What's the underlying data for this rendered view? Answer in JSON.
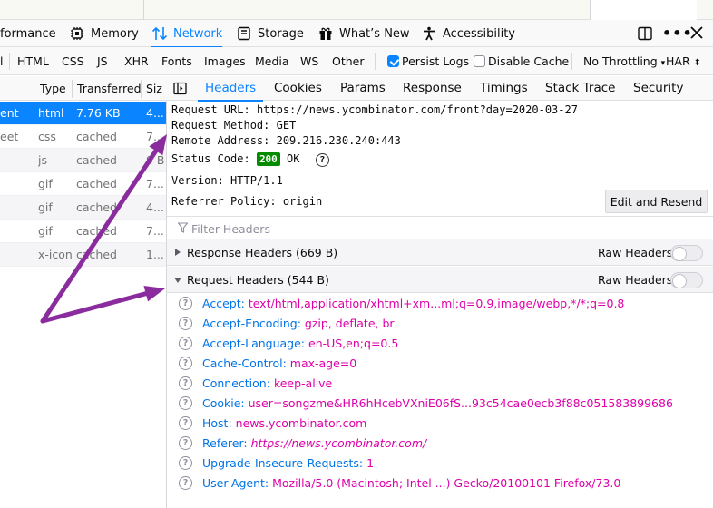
{
  "toolbar": {
    "tabs": [
      {
        "label": "formance",
        "icon": "performance-icon"
      },
      {
        "label": "Memory",
        "icon": "memory-icon"
      },
      {
        "label": "Network",
        "icon": "network-icon",
        "active": true
      },
      {
        "label": "Storage",
        "icon": "storage-icon"
      },
      {
        "label": "What’s New",
        "icon": "gift-icon"
      },
      {
        "label": "Accessibility",
        "icon": "accessibility-icon"
      }
    ],
    "dock_icon": "dock-side-icon",
    "more_icon": "more-icon",
    "close_icon": "close-icon"
  },
  "filterbar": {
    "types": [
      "l",
      "HTML",
      "CSS",
      "JS",
      "XHR",
      "Fonts",
      "Images",
      "Media",
      "WS",
      "Other"
    ],
    "persist_logs": {
      "label": "Persist Logs",
      "checked": true
    },
    "disable_cache": {
      "label": "Disable Cache",
      "checked": false
    },
    "throttling": "No Throttling",
    "har": "HAR"
  },
  "request_list": {
    "columns": [
      "Type",
      "Transferred",
      "Siz"
    ],
    "rows": [
      {
        "name": "ent",
        "type": "html",
        "transferred": "7.76 KB",
        "size": "4...",
        "selected": true
      },
      {
        "name": "eet",
        "type": "css",
        "transferred": "cached",
        "size": "7..."
      },
      {
        "name": "",
        "type": "js",
        "transferred": "cached",
        "size": "9 B"
      },
      {
        "name": "",
        "type": "gif",
        "transferred": "cached",
        "size": "7..."
      },
      {
        "name": "",
        "type": "gif",
        "transferred": "cached",
        "size": "4..."
      },
      {
        "name": "",
        "type": "gif",
        "transferred": "cached",
        "size": "7..."
      },
      {
        "name": "",
        "type": "x-icon",
        "transferred": "cached",
        "size": "1..."
      }
    ]
  },
  "details": {
    "tabs": [
      "Headers",
      "Cookies",
      "Params",
      "Response",
      "Timings",
      "Stack Trace",
      "Security"
    ],
    "active_tab": "Headers",
    "request_url_label": "Request URL:",
    "request_url": "https://news.ycombinator.com/front?day=2020-03-27",
    "request_method_label": "Request Method:",
    "request_method": "GET",
    "remote_address_label": "Remote Address:",
    "remote_address": "209.216.230.240:443",
    "status_code_label": "Status Code:",
    "status_code": "200",
    "status_text": "OK",
    "version_label": "Version:",
    "version": "HTTP/1.1",
    "referrer_policy_label": "Referrer Policy:",
    "referrer_policy": "origin",
    "edit_resend": "Edit and Resend",
    "filter_placeholder": "Filter Headers",
    "response_headers_title": "Response Headers (669 B)",
    "request_headers_title": "Request Headers (544 B)",
    "raw_headers_label": "Raw Headers",
    "request_headers": [
      {
        "name": "Accept:",
        "value": "text/html,application/xhtml+xm...ml;q=0.9,image/webp,*/*;q=0.8"
      },
      {
        "name": "Accept-Encoding:",
        "value": "gzip, deflate, br"
      },
      {
        "name": "Accept-Language:",
        "value": "en-US,en;q=0.5"
      },
      {
        "name": "Cache-Control:",
        "value": "max-age=0"
      },
      {
        "name": "Connection:",
        "value": "keep-alive"
      },
      {
        "name": "Cookie:",
        "value": "user=songzme&HR6hHcebVXniE06fS...93c54cae0ecb3f88c051583899686"
      },
      {
        "name": "Host:",
        "value": "news.ycombinator.com"
      },
      {
        "name": "Referer:",
        "value": "https://news.ycombinator.com/",
        "italic": true
      },
      {
        "name": "Upgrade-Insecure-Requests:",
        "value": "1"
      },
      {
        "name": "User-Agent:",
        "value": "Mozilla/5.0 (Macintosh; Intel ...) Gecko/20100101 Firefox/73.0"
      }
    ]
  },
  "annotation": {
    "arrow_color": "#8b2c9e"
  }
}
